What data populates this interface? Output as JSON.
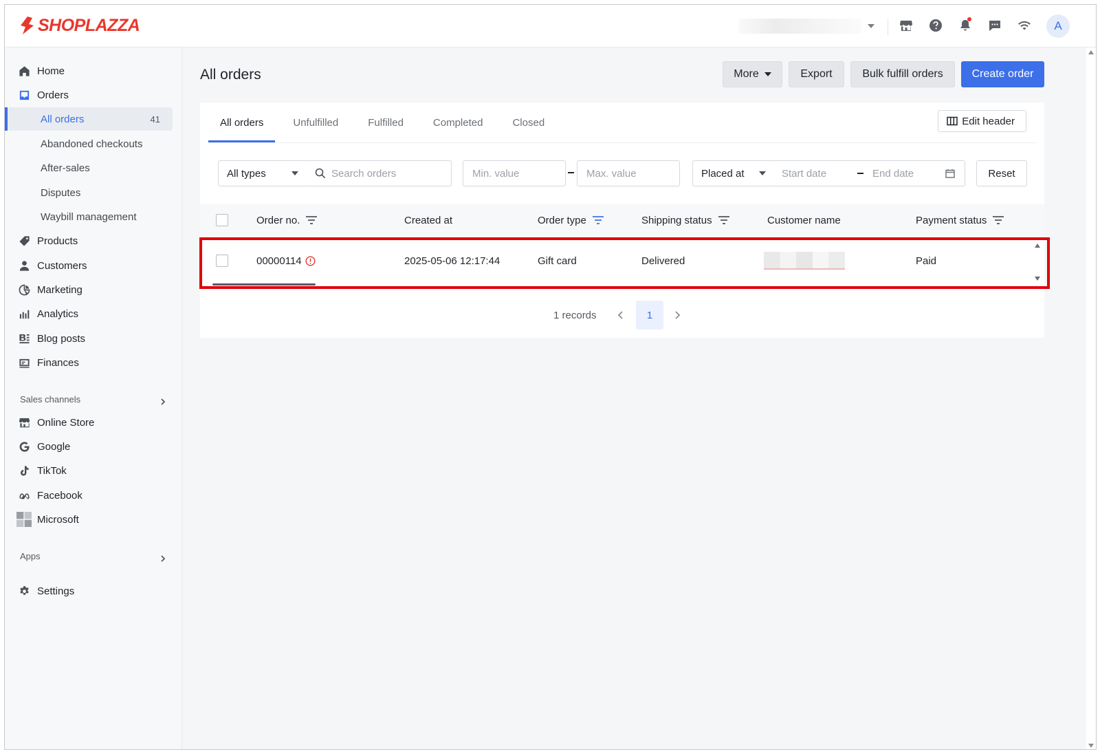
{
  "brand": {
    "name": "SHOPLAZZA",
    "color": "#e8372c"
  },
  "topbar": {
    "icons": [
      "store-icon",
      "help-icon",
      "bell-icon",
      "chat-icon",
      "wifi-icon"
    ],
    "avatar_initial": "A"
  },
  "sidebar": {
    "home": "Home",
    "orders": "Orders",
    "orders_sub": {
      "all_orders": "All orders",
      "all_orders_count": "41",
      "abandoned": "Abandoned checkouts",
      "after_sales": "After-sales",
      "disputes": "Disputes",
      "waybill": "Waybill management"
    },
    "products": "Products",
    "customers": "Customers",
    "marketing": "Marketing",
    "analytics": "Analytics",
    "blog_posts": "Blog posts",
    "finances": "Finances",
    "sales_channels": "Sales channels",
    "online_store": "Online Store",
    "google": "Google",
    "tiktok": "TikTok",
    "facebook": "Facebook",
    "microsoft": "Microsoft",
    "apps": "Apps",
    "settings": "Settings"
  },
  "page": {
    "title": "All orders",
    "more": "More",
    "export": "Export",
    "bulk_fulfill": "Bulk fulfill orders",
    "create_order": "Create order",
    "accent": "#3c6fe8"
  },
  "tabs": {
    "all": "All orders",
    "unfulfilled": "Unfulfilled",
    "fulfilled": "Fulfilled",
    "completed": "Completed",
    "closed": "Closed",
    "edit_header": "Edit header"
  },
  "filters": {
    "type": "All types",
    "search_placeholder": "Search orders",
    "min_placeholder": "Min. value",
    "max_placeholder": "Max. value",
    "date_field": "Placed at",
    "start_placeholder": "Start date",
    "end_placeholder": "End date",
    "reset": "Reset"
  },
  "table": {
    "columns": {
      "order_no": "Order no.",
      "created_at": "Created at",
      "order_type": "Order type",
      "shipping_status": "Shipping status",
      "customer_name": "Customer name",
      "payment_status": "Payment status"
    },
    "rows": [
      {
        "order_no": "00000114",
        "created_at": "2025-05-06 12:17:44",
        "order_type": "Gift card",
        "shipping_status": "Delivered",
        "payment_status": "Paid"
      }
    ]
  },
  "pagination": {
    "records": "1 records",
    "page": "1"
  }
}
